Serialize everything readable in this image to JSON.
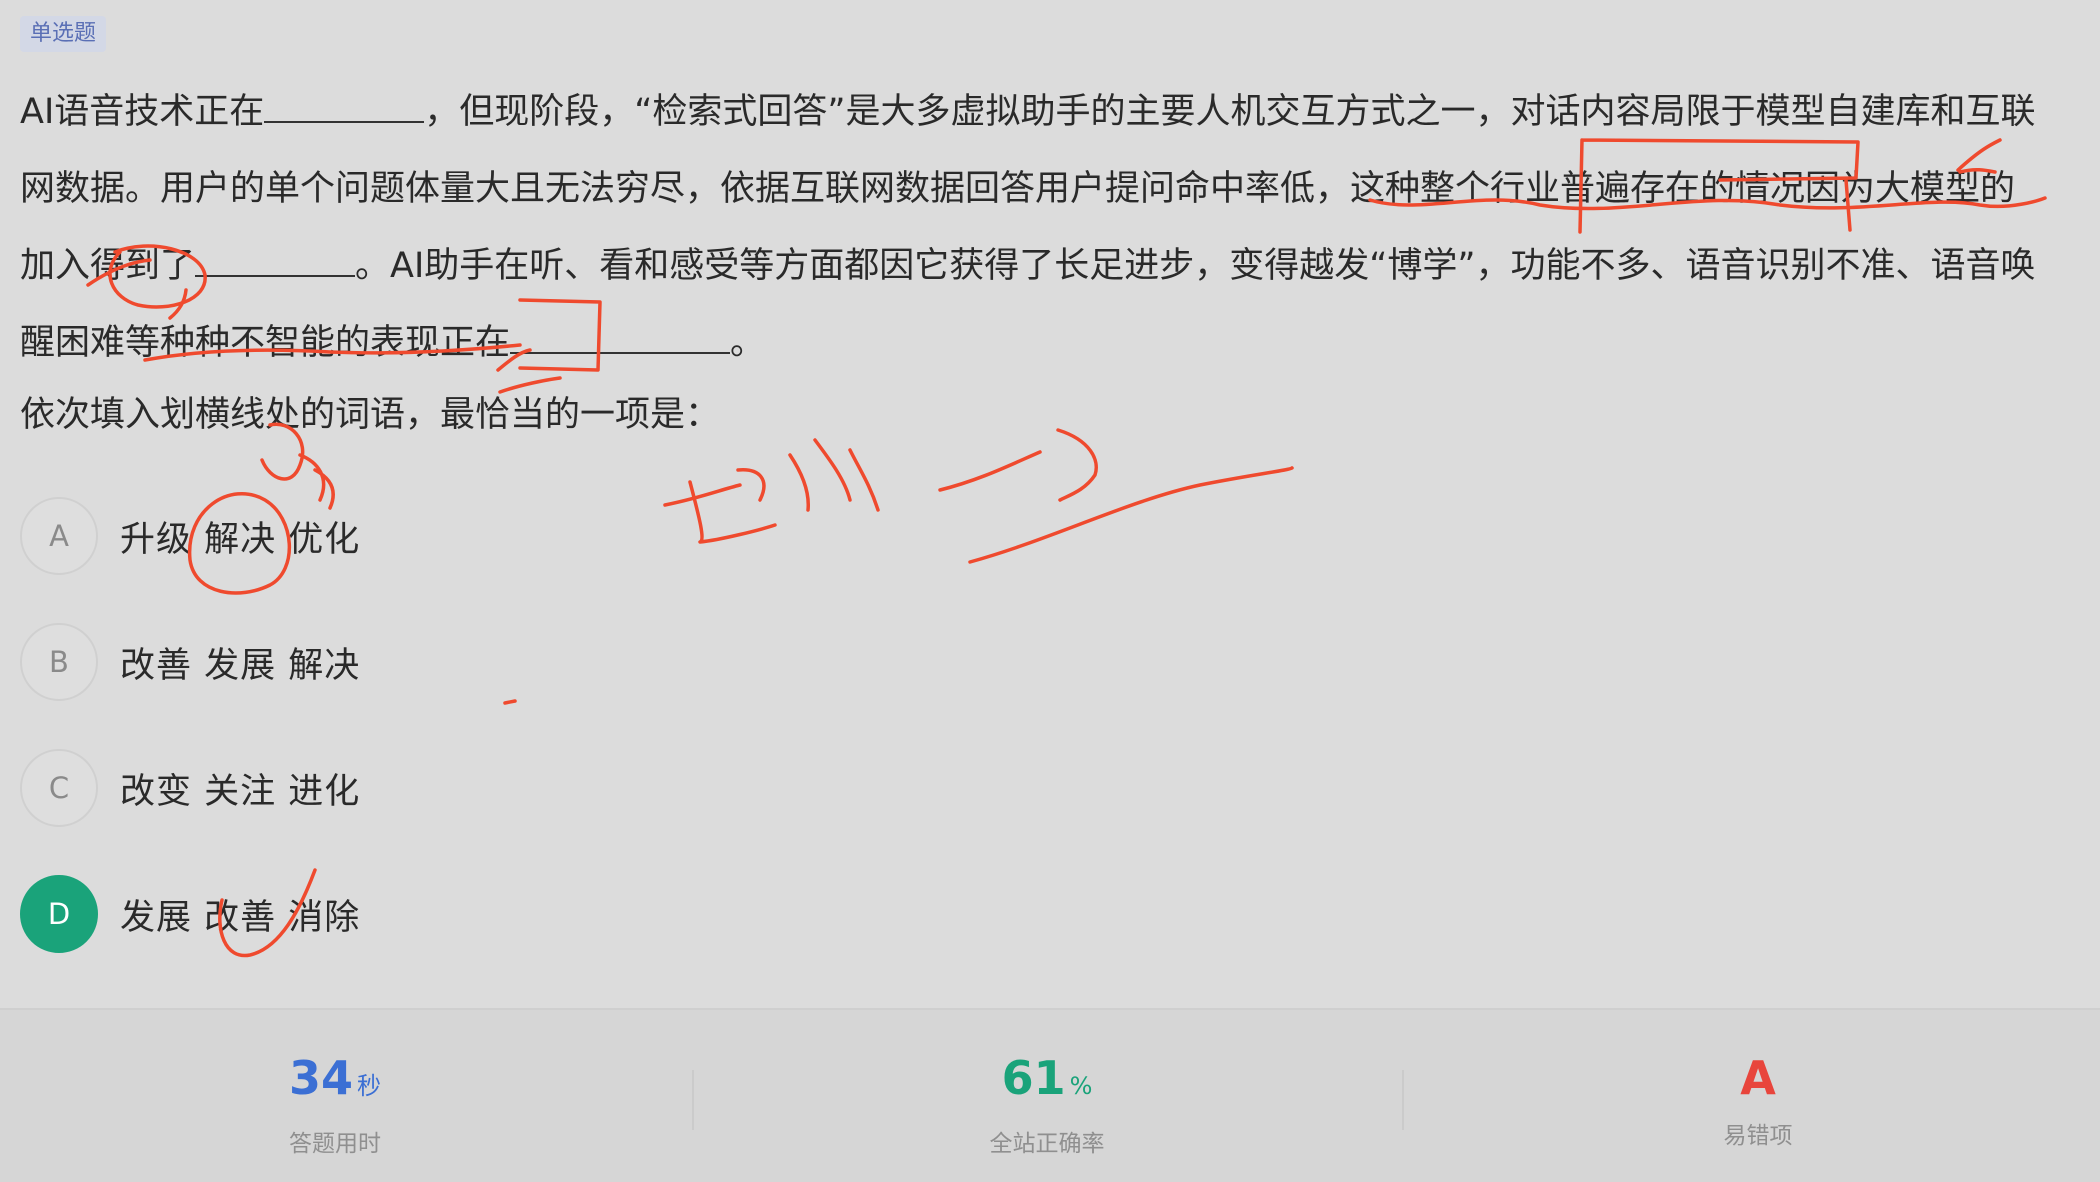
{
  "question_type_tag": "单选题",
  "question": {
    "line1_a": "AI语音技术正在",
    "line1_b": "，但现阶段，“检索式回答”是大多虚拟助手的主要人机交互方式之一，对话内容局限于模型自建库和互联",
    "line2": "网数据。用户的单个问题体量大且无法穷尽，依据互联网数据回答用户提问命中率低，这种整个行业普遍存在的情况因为大模型的",
    "line3_a": "加入得到了",
    "line3_b": "。AI助手在听、看和感受等方面都因它获得了长足进步，变得越发“博学”，功能不多、语音识别不准、语音唤",
    "line4_a": "醒困难等种种不智能的表现正在",
    "line4_b": "。"
  },
  "prompt": "依次填入划横线处的词语，最恰当的一项是：",
  "options": [
    {
      "letter": "A",
      "text": "升级 解决 优化",
      "selected": false
    },
    {
      "letter": "B",
      "text": "改善 发展 解决",
      "selected": false
    },
    {
      "letter": "C",
      "text": "改变 关注 进化",
      "selected": false
    },
    {
      "letter": "D",
      "text": "发展 改善 消除",
      "selected": true
    }
  ],
  "stats": {
    "time": {
      "value": "34",
      "unit": "秒",
      "label": "答题用时",
      "color": "#3b6fd4"
    },
    "accuracy": {
      "value": "61",
      "unit": "%",
      "label": "全站正确率",
      "color": "#1aa37a"
    },
    "common_error": {
      "value": "A",
      "unit": "",
      "label": "易错项",
      "color": "#e8453c"
    }
  },
  "colors": {
    "selected_option": "#1aa37a",
    "annotation_ink": "#ef4a2e"
  }
}
